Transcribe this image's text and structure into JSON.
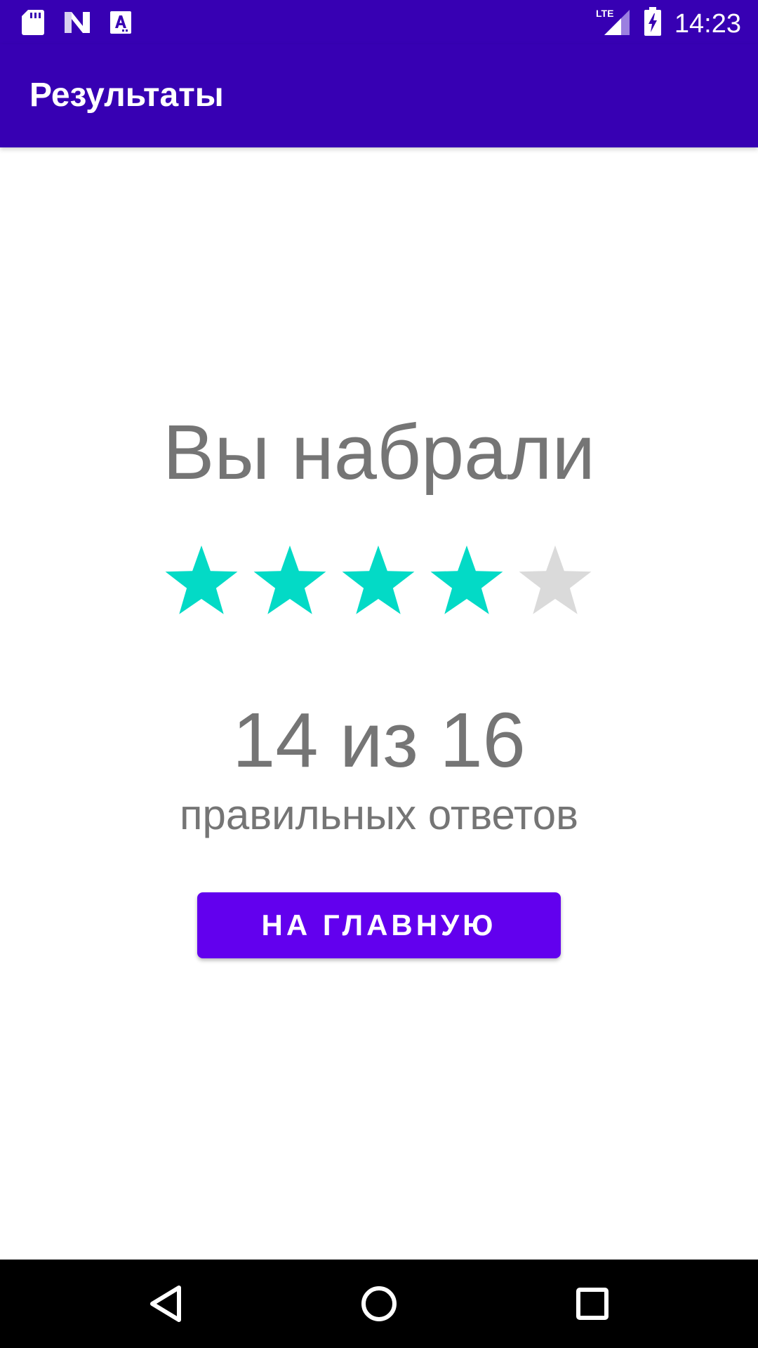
{
  "status_bar": {
    "time": "14:23",
    "network": "LTE",
    "icons_left": [
      "sd-card-icon",
      "n-notification-icon",
      "a-notification-icon"
    ],
    "icons_right": [
      "lte-signal-icon",
      "battery-charging-icon"
    ]
  },
  "app_bar": {
    "title": "Результаты"
  },
  "result": {
    "headline": "Вы набрали",
    "rating": {
      "filled": 4,
      "total": 5,
      "filled_color": "#03dac6",
      "empty_color": "#dadada"
    },
    "score": "14 из 16",
    "subtitle": "правильных ответов"
  },
  "actions": {
    "home_button_label": "НА ГЛАВНУЮ",
    "home_button_color": "#6200ee"
  },
  "colors": {
    "primary_dark": "#3700b3",
    "text_secondary": "#757575"
  },
  "nav_bar": {
    "items": [
      "back-icon",
      "home-icon",
      "recents-icon"
    ]
  }
}
